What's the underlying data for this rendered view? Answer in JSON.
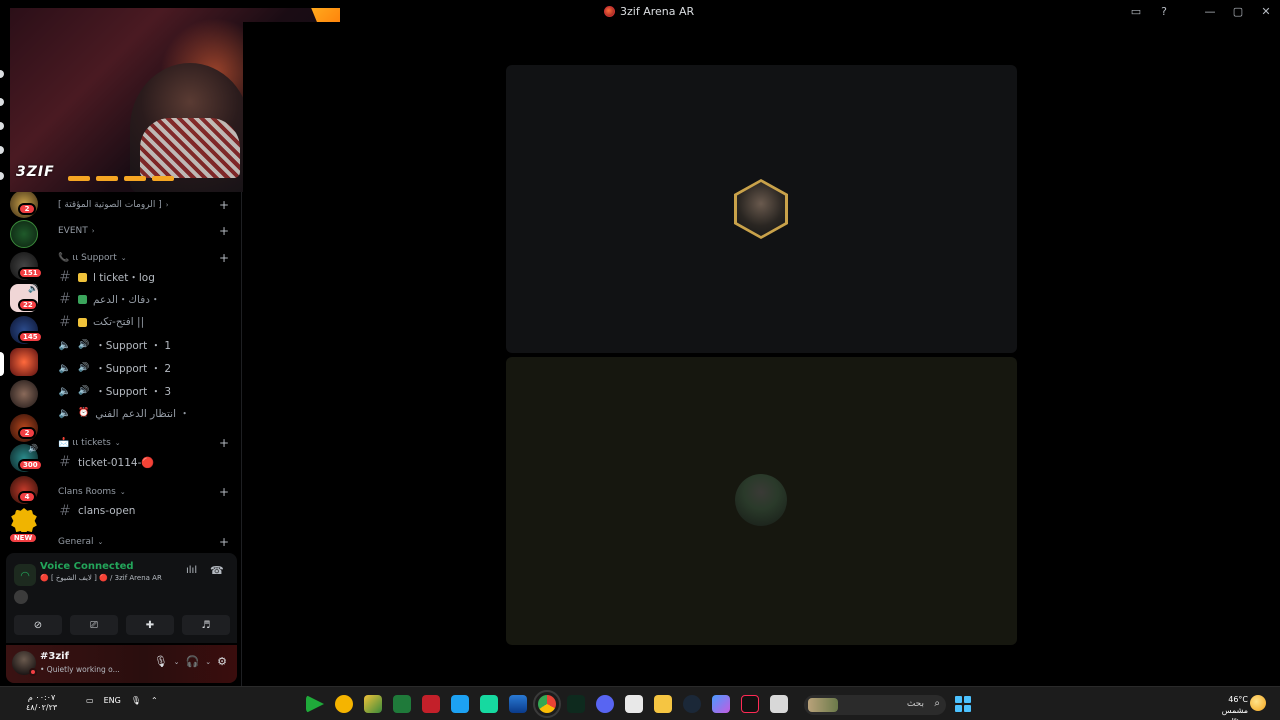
{
  "window": {
    "title": "3zif Arena AR",
    "controls": [
      "inbox-icon",
      "help-icon",
      "minimize-icon",
      "maximize-icon",
      "close-icon"
    ]
  },
  "server_rail": {
    "badges": [
      "2",
      "151",
      "22",
      "145",
      "2",
      "300",
      "4"
    ],
    "new_badge": "NEW"
  },
  "sidebar": {
    "categories": [
      {
        "label": "[ الرومات الصوتية المؤقتة ]"
      },
      {
        "label": "EVENT"
      },
      {
        "label": "ιι Support"
      },
      {
        "label": "ιι tickets"
      },
      {
        "label": "Clans Rooms"
      },
      {
        "label": "General"
      }
    ],
    "channels": [
      {
        "type": "text",
        "label": "ا ticket・log",
        "color": "#f0c23a"
      },
      {
        "type": "text",
        "label": "دفاك・الدعم・",
        "color": "#3ba55c"
      },
      {
        "type": "text",
        "label": "افتح-تكت ||",
        "color": "#f0c23a"
      },
      {
        "type": "voice",
        "label": "・Support ・ 1"
      },
      {
        "type": "voice",
        "label": "・Support ・ 2"
      },
      {
        "type": "voice",
        "label": "・Support ・ 3"
      },
      {
        "type": "voice",
        "label": "انتظار الدعم الفني ・"
      },
      {
        "type": "text",
        "label": "ticket-0114-🔴"
      },
      {
        "type": "text",
        "label": "clans-open"
      }
    ]
  },
  "voice_panel": {
    "status": "Voice Connected",
    "channel": "🔴 [ لايف الشيوخ ] 🔴 / 3zif Arena AR",
    "buttons": [
      "video-off-icon",
      "screen-share-icon",
      "activities-icon",
      "soundboard-icon"
    ]
  },
  "user_panel": {
    "username": "#3zif",
    "status": "• Quietly working o..."
  },
  "taskbar": {
    "time": "٠٠:٠٧ م",
    "date": "٤٨/٠٢/٢٣",
    "language": "ENG",
    "search_placeholder": "بحث",
    "temperature": "46°C",
    "weather": "مشمس جزئيًا"
  }
}
